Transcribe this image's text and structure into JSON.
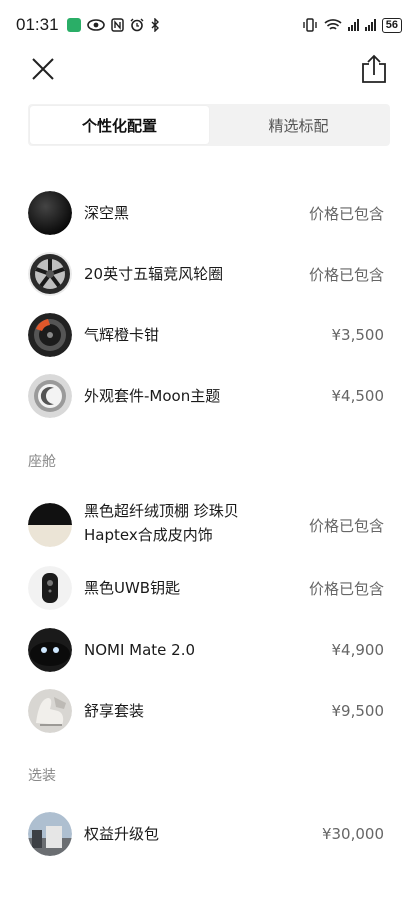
{
  "status_bar": {
    "time": "01:31",
    "battery": "56"
  },
  "tabs": [
    {
      "label": "个性化配置",
      "active": true
    },
    {
      "label": "精选标配",
      "active": false
    }
  ],
  "exterior": {
    "items": [
      {
        "name": "深空黑",
        "price": "价格已包含",
        "icon": "black-paint-swatch"
      },
      {
        "name": "20英寸五辐竞风轮圈",
        "price": "价格已包含",
        "icon": "wheel-rim"
      },
      {
        "name": "气辉橙卡钳",
        "price": "¥3,500",
        "icon": "orange-caliper"
      },
      {
        "name": "外观套件-Moon主题",
        "price": "¥4,500",
        "icon": "moon-theme-kit"
      }
    ]
  },
  "cabin": {
    "title": "座舱",
    "items": [
      {
        "name_line1": "黑色超纤绒顶棚 珍珠贝",
        "name_line2": "Haptex合成皮内饰",
        "price": "价格已包含",
        "icon": "interior-trim"
      },
      {
        "name": "黑色UWB钥匙",
        "price": "价格已包含",
        "icon": "uwb-key"
      },
      {
        "name": "NOMI Mate 2.0",
        "price": "¥4,900",
        "icon": "nomi-mate"
      },
      {
        "name": "舒享套装",
        "price": "¥9,500",
        "icon": "comfort-seat"
      }
    ]
  },
  "options": {
    "title": "选装",
    "items": [
      {
        "name": "权益升级包",
        "price": "¥30,000",
        "icon": "benefit-package"
      }
    ]
  }
}
